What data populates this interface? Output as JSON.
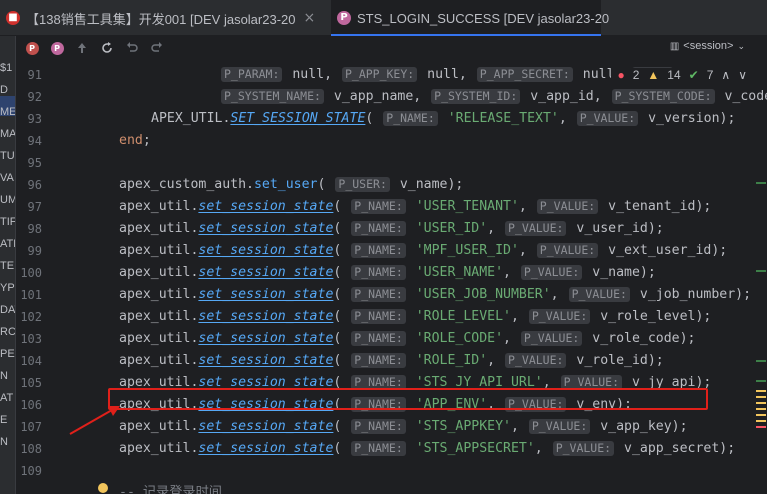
{
  "tabs": [
    {
      "label": "【138销售工具集】开发001 [DEV  jasolar23-20",
      "icon": "db-icon",
      "icon_glyph": "■"
    },
    {
      "label": "STS_LOGIN_SUCCESS [DEV  jasolar23-20",
      "icon": "procedure-icon",
      "icon_glyph": "P"
    }
  ],
  "tab_close_glyph": "×",
  "left_strip_labels": [
    "$1",
    "D",
    "ME",
    "MA",
    "TUS",
    "VA",
    "UM",
    "TIF",
    "ATE",
    "TE",
    "YP",
    "DAT",
    "RCI",
    "PER",
    "N",
    "AT",
    "E",
    "N"
  ],
  "toolbar": {
    "session_label": "<session>"
  },
  "inspections": {
    "errors": "2",
    "warnings": "14",
    "ok": "7"
  },
  "lines": [
    {
      "n": "91",
      "tokens": [
        [
          "i",
          "P_PARAM:"
        ],
        [
          "p",
          " null, "
        ],
        [
          "i",
          "P_APP_KEY:"
        ],
        [
          "p",
          " null, "
        ],
        [
          "i",
          "P_APP_SECRET:"
        ],
        [
          "p",
          " null, "
        ],
        [
          "i",
          "P_SYS"
        ]
      ],
      "indent": 100
    },
    {
      "n": "92",
      "tokens": [
        [
          "i",
          "P_SYSTEM_NAME:"
        ],
        [
          "p",
          " v_app_name, "
        ],
        [
          "i",
          "P_SYSTEM_ID:"
        ],
        [
          "p",
          " v_app_id, "
        ],
        [
          "i",
          "P_SYSTEM_CODE:"
        ],
        [
          "p",
          " v_code"
        ]
      ],
      "indent": 100
    },
    {
      "n": "93",
      "tokens": [
        [
          "p",
          "APEX_UTIL."
        ],
        [
          "f",
          "SET_SESSION_STATE"
        ],
        [
          "p",
          "( "
        ],
        [
          "i",
          "P_NAME:"
        ],
        [
          "s",
          " 'RELEASE_TEXT'"
        ],
        [
          "p",
          ", "
        ],
        [
          "i",
          "P_VALUE:"
        ],
        [
          "p",
          " v_version);"
        ]
      ],
      "indent": 32
    },
    {
      "n": "94",
      "tokens": [
        [
          "k",
          "end"
        ],
        [
          "p",
          ";"
        ]
      ],
      "indent": 0
    },
    {
      "n": "95",
      "tokens": [],
      "indent": 0
    },
    {
      "n": "96",
      "tokens": [
        [
          "p",
          "apex_custom_auth."
        ],
        [
          "g",
          "set_user"
        ],
        [
          "p",
          "( "
        ],
        [
          "i",
          "P_USER:"
        ],
        [
          "p",
          " v_name);"
        ]
      ],
      "indent": 0
    },
    {
      "n": "97",
      "tokens": [
        [
          "p",
          "apex_util."
        ],
        [
          "f",
          "set_session_state"
        ],
        [
          "p",
          "( "
        ],
        [
          "i",
          "P_NAME:"
        ],
        [
          "s",
          " 'USER_TENANT'"
        ],
        [
          "p",
          ", "
        ],
        [
          "i",
          "P_VALUE:"
        ],
        [
          "p",
          " v_tenant_id);"
        ]
      ],
      "indent": 0
    },
    {
      "n": "98",
      "tokens": [
        [
          "p",
          "apex_util."
        ],
        [
          "f",
          "set_session_state"
        ],
        [
          "p",
          "( "
        ],
        [
          "i",
          "P_NAME:"
        ],
        [
          "s",
          " 'USER_ID'"
        ],
        [
          "p",
          ", "
        ],
        [
          "i",
          "P_VALUE:"
        ],
        [
          "p",
          " v_user_id);"
        ]
      ],
      "indent": 0
    },
    {
      "n": "99",
      "tokens": [
        [
          "p",
          "apex_util."
        ],
        [
          "f",
          "set_session_state"
        ],
        [
          "p",
          "( "
        ],
        [
          "i",
          "P_NAME:"
        ],
        [
          "s",
          " 'MPF_USER_ID'"
        ],
        [
          "p",
          ", "
        ],
        [
          "i",
          "P_VALUE:"
        ],
        [
          "p",
          " v_ext_user_id);"
        ]
      ],
      "indent": 0
    },
    {
      "n": "100",
      "tokens": [
        [
          "p",
          "apex_util."
        ],
        [
          "f",
          "set_session_state"
        ],
        [
          "p",
          "( "
        ],
        [
          "i",
          "P_NAME:"
        ],
        [
          "s",
          " 'USER_NAME'"
        ],
        [
          "p",
          ", "
        ],
        [
          "i",
          "P_VALUE:"
        ],
        [
          "p",
          " v_name);"
        ]
      ],
      "indent": 0
    },
    {
      "n": "101",
      "tokens": [
        [
          "p",
          "apex_util."
        ],
        [
          "f",
          "set_session_state"
        ],
        [
          "p",
          "( "
        ],
        [
          "i",
          "P_NAME:"
        ],
        [
          "s",
          " 'USER_JOB_NUMBER'"
        ],
        [
          "p",
          ", "
        ],
        [
          "i",
          "P_VALUE:"
        ],
        [
          "p",
          " v_job_number);"
        ]
      ],
      "indent": 0
    },
    {
      "n": "102",
      "tokens": [
        [
          "p",
          "apex_util."
        ],
        [
          "f",
          "set_session_state"
        ],
        [
          "p",
          "( "
        ],
        [
          "i",
          "P_NAME:"
        ],
        [
          "s",
          " 'ROLE_LEVEL'"
        ],
        [
          "p",
          ", "
        ],
        [
          "i",
          "P_VALUE:"
        ],
        [
          "p",
          " v_role_level);"
        ]
      ],
      "indent": 0
    },
    {
      "n": "103",
      "tokens": [
        [
          "p",
          "apex_util."
        ],
        [
          "f",
          "set_session_state"
        ],
        [
          "p",
          "( "
        ],
        [
          "i",
          "P_NAME:"
        ],
        [
          "s",
          " 'ROLE_CODE'"
        ],
        [
          "p",
          ", "
        ],
        [
          "i",
          "P_VALUE:"
        ],
        [
          "p",
          " v_role_code);"
        ]
      ],
      "indent": 0
    },
    {
      "n": "104",
      "tokens": [
        [
          "p",
          "apex_util."
        ],
        [
          "f",
          "set_session_state"
        ],
        [
          "p",
          "( "
        ],
        [
          "i",
          "P_NAME:"
        ],
        [
          "s",
          " 'ROLE_ID'"
        ],
        [
          "p",
          ", "
        ],
        [
          "i",
          "P_VALUE:"
        ],
        [
          "p",
          " v_role_id);"
        ]
      ],
      "indent": 0
    },
    {
      "n": "105",
      "tokens": [
        [
          "p",
          "apex_util."
        ],
        [
          "f",
          "set_session_state"
        ],
        [
          "p",
          "( "
        ],
        [
          "i",
          "P_NAME:"
        ],
        [
          "s",
          " 'STS_JY_API_URL'"
        ],
        [
          "p",
          ", "
        ],
        [
          "i",
          "P_VALUE:"
        ],
        [
          "p",
          " v_jy_api);"
        ]
      ],
      "indent": 0
    },
    {
      "n": "106",
      "tokens": [
        [
          "p",
          "apex_util."
        ],
        [
          "f",
          "set_session_state"
        ],
        [
          "p",
          "( "
        ],
        [
          "i",
          "P_NAME:"
        ],
        [
          "s",
          " 'APP_ENV'"
        ],
        [
          "p",
          ", "
        ],
        [
          "i",
          "P_VALUE:"
        ],
        [
          "p",
          " v_env);"
        ]
      ],
      "indent": 0
    },
    {
      "n": "107",
      "tokens": [
        [
          "p",
          "apex_util."
        ],
        [
          "f",
          "set_session_state"
        ],
        [
          "p",
          "( "
        ],
        [
          "i",
          "P_NAME:"
        ],
        [
          "s",
          " 'STS_APPKEY'"
        ],
        [
          "p",
          ", "
        ],
        [
          "i",
          "P_VALUE:"
        ],
        [
          "p",
          " v_app_key);"
        ]
      ],
      "indent": 0
    },
    {
      "n": "108",
      "tokens": [
        [
          "p",
          "apex_util."
        ],
        [
          "f",
          "set_session_state"
        ],
        [
          "p",
          "( "
        ],
        [
          "i",
          "P_NAME:"
        ],
        [
          "s",
          " 'STS_APPSECRET'"
        ],
        [
          "p",
          ", "
        ],
        [
          "i",
          "P_VALUE:"
        ],
        [
          "p",
          " v_app_secret);"
        ]
      ],
      "indent": 0
    },
    {
      "n": "109",
      "tokens": [],
      "indent": 0
    },
    {
      "n": "",
      "tokens": [
        [
          "c",
          "-- 记录登录时间"
        ]
      ],
      "indent": 0
    }
  ],
  "highlighted_line": "103",
  "colors": {
    "highlight_box": "#e0201a",
    "accent": "#3574f0"
  }
}
